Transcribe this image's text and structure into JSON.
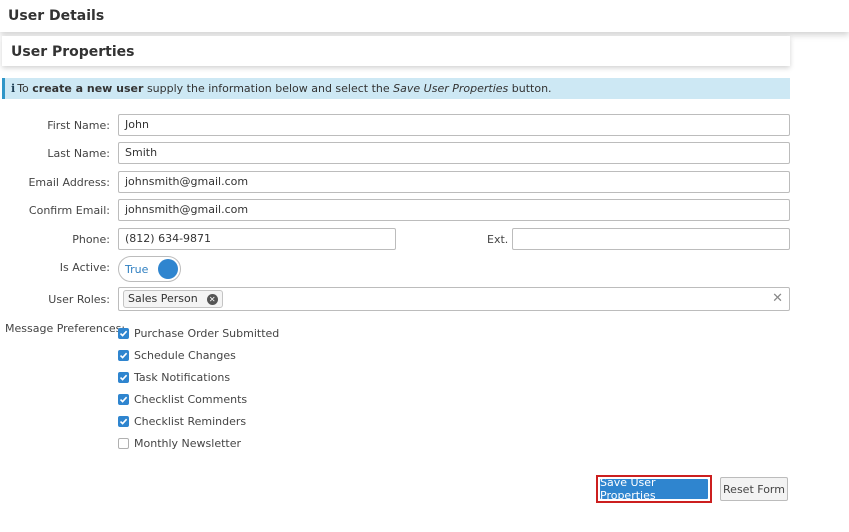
{
  "window": {
    "title": "User Details"
  },
  "panel": {
    "title": "User Properties"
  },
  "info": {
    "prefix": "To ",
    "bold": "create a new user",
    "middle": " supply the information below and select the ",
    "italic": "Save User Properties",
    "suffix": " button."
  },
  "form": {
    "first_name": {
      "label": "First Name:",
      "value": "John"
    },
    "last_name": {
      "label": "Last Name:",
      "value": "Smith"
    },
    "email": {
      "label": "Email Address:",
      "value": "johnsmith@gmail.com"
    },
    "confirm_email": {
      "label": "Confirm Email:",
      "value": "johnsmith@gmail.com"
    },
    "phone": {
      "label": "Phone:",
      "value": "(812) 634-9871"
    },
    "ext": {
      "label": "Ext.",
      "value": ""
    },
    "is_active": {
      "label": "Is Active:",
      "value": "True"
    },
    "user_roles": {
      "label": "User Roles:",
      "chips": [
        "Sales Person"
      ],
      "clear_glyph": "✕"
    },
    "message_prefs": {
      "label": "Message Preferences:",
      "options": [
        {
          "label": "Purchase Order Submitted",
          "checked": true
        },
        {
          "label": "Schedule Changes",
          "checked": true
        },
        {
          "label": "Task Notifications",
          "checked": true
        },
        {
          "label": "Checklist Comments",
          "checked": true
        },
        {
          "label": "Checklist Reminders",
          "checked": true
        },
        {
          "label": "Monthly Newsletter",
          "checked": false
        }
      ]
    }
  },
  "buttons": {
    "save": "Save User Properties",
    "reset": "Reset Form"
  },
  "colors": {
    "accent": "#2f85cf",
    "info_bg": "#cde8f4",
    "highlight": "#cc1f1f"
  }
}
